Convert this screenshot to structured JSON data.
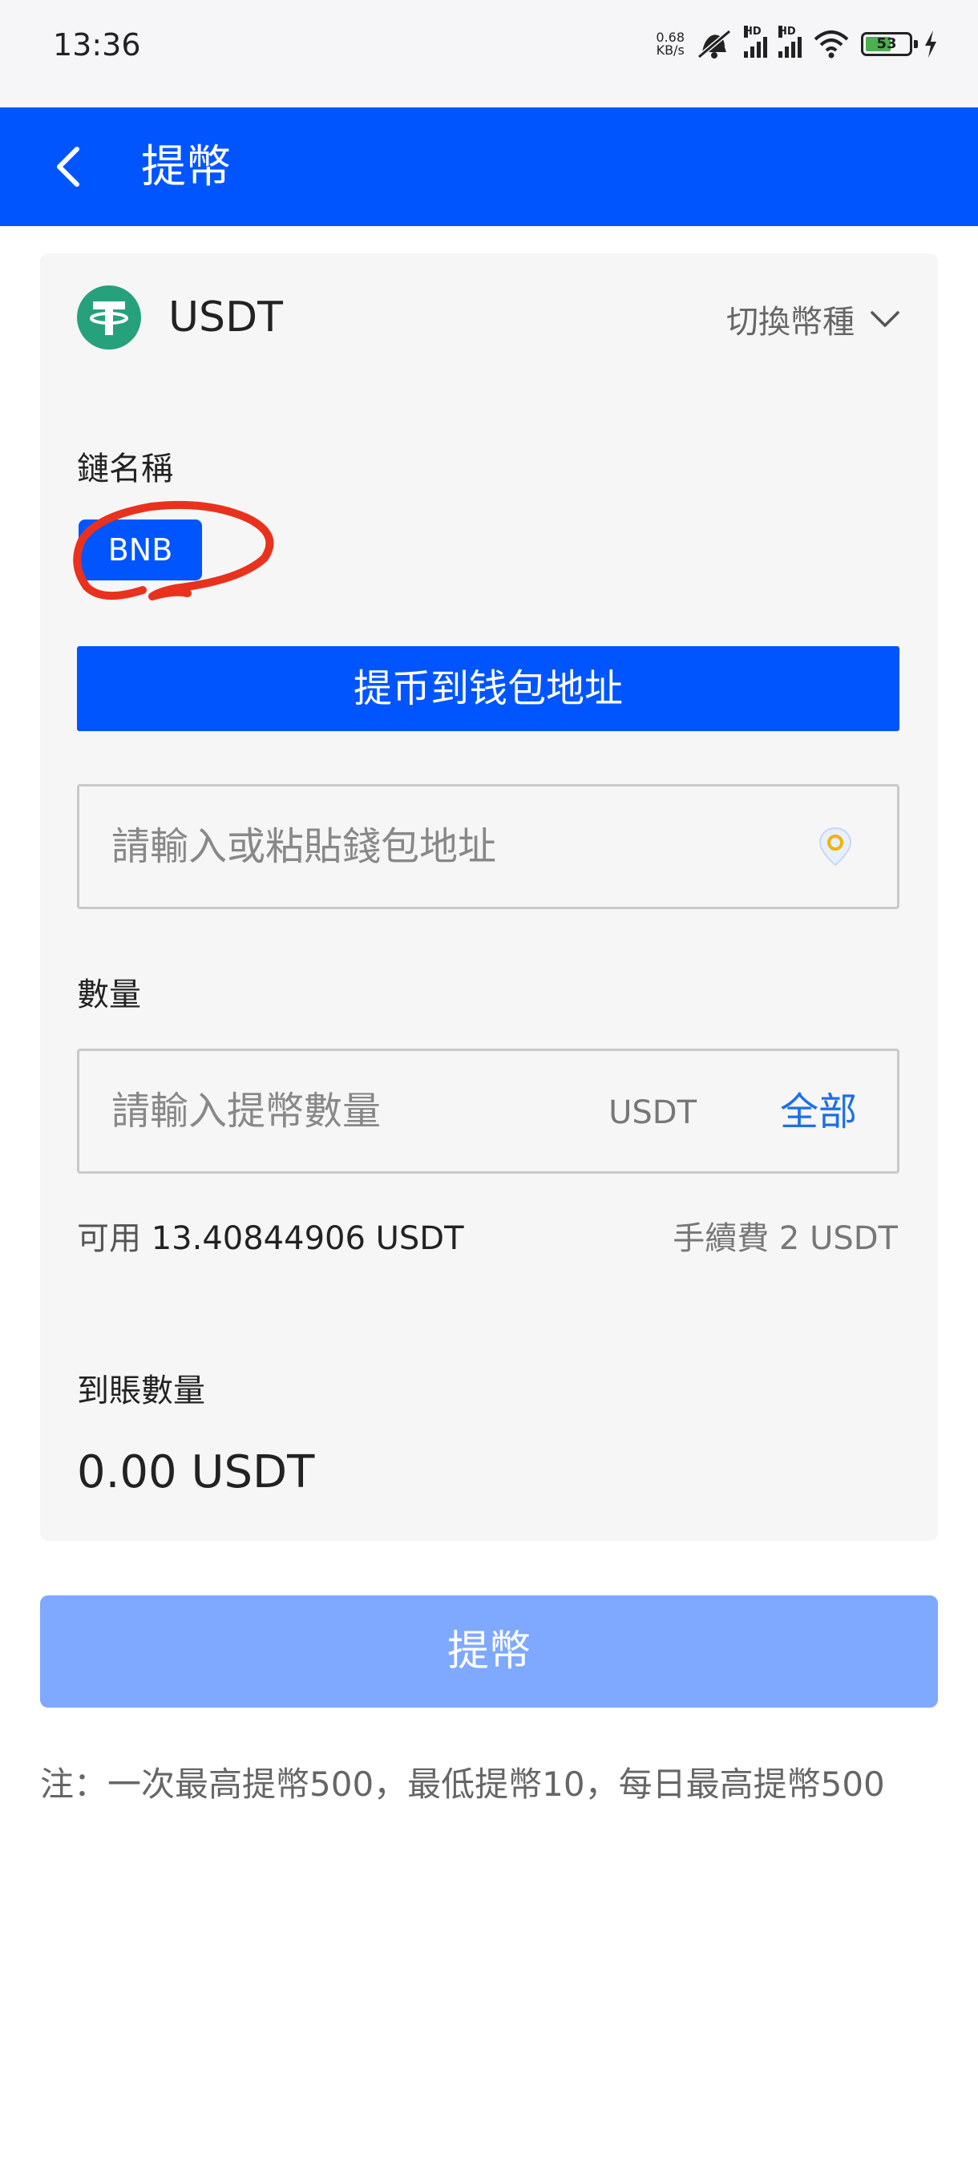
{
  "status_bar": {
    "time": "13:36",
    "net_speed_value": "0.68",
    "net_speed_unit": "KB/s",
    "signal_label_1": "HD",
    "signal_label_2": "HD",
    "battery_level": "53",
    "icons": [
      "mute-icon",
      "signal-icon",
      "signal-icon",
      "wifi-icon",
      "battery-icon",
      "charging-icon"
    ]
  },
  "header": {
    "title": "提幣",
    "back_icon": "chevron-left-icon"
  },
  "coin": {
    "name": "USDT",
    "switch_label": "切換幣種",
    "logo_color": "#26a17b"
  },
  "chain": {
    "label": "鏈名稱",
    "selected": "BNB"
  },
  "wallet_button": "提币到钱包地址",
  "address_input": {
    "placeholder": "請輸入或粘貼錢包地址",
    "value": ""
  },
  "quantity": {
    "label": "數量",
    "placeholder": "請輸入提幣數量",
    "unit": "USDT",
    "all_label": "全部",
    "value": ""
  },
  "available": {
    "label": "可用",
    "value": "13.40844906 USDT"
  },
  "fee": {
    "label": "手續費",
    "value": "2 USDT"
  },
  "receive": {
    "label": "到賬數量",
    "amount": "0.00 USDT"
  },
  "submit_label": "提幣",
  "note": "注：一次最高提幣500，最低提幣10，每日最高提幣500",
  "colors": {
    "primary": "#0055ff",
    "primary_disabled": "#7fa8ff",
    "link": "#1e6fe5",
    "annotation": "#e8321e"
  }
}
